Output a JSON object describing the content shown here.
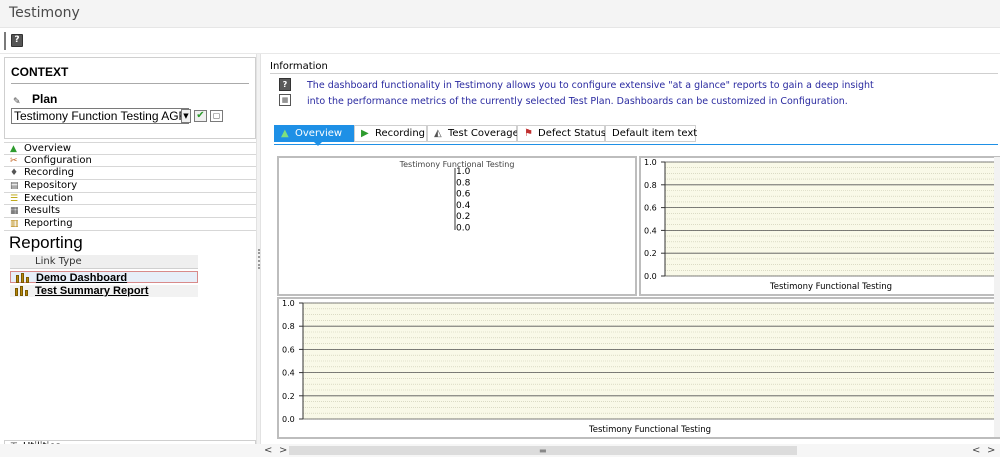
{
  "app": {
    "title": "Testimony"
  },
  "toolbar": {
    "help_icon": "help-icon"
  },
  "context": {
    "title": "CONTEXT",
    "plan_label": "Plan",
    "plan_value": "Testimony Function Testing AGR"
  },
  "nav": {
    "items": [
      {
        "label": "Overview",
        "icon": "overview-icon"
      },
      {
        "label": "Configuration",
        "icon": "configuration-icon"
      },
      {
        "label": "Recording",
        "icon": "recording-icon"
      },
      {
        "label": "Repository",
        "icon": "repository-icon"
      },
      {
        "label": "Execution",
        "icon": "execution-icon"
      },
      {
        "label": "Results",
        "icon": "results-icon"
      },
      {
        "label": "Reporting",
        "icon": "reporting-icon"
      }
    ]
  },
  "reporting": {
    "heading": "Reporting",
    "column_header": "Link Type",
    "links": [
      "Demo Dashboard",
      "Test Summary Report"
    ]
  },
  "utilities": {
    "label": "Utilities"
  },
  "information": {
    "label": "Information",
    "line1": "The dashboard functionality in Testimony allows you to configure extensive \"at a glance\" reports to gain a deep insight",
    "line2": "into the performance metrics of the currently selected Test Plan. Dashboards can be customized in Configuration."
  },
  "tabs": [
    {
      "label": "Overview",
      "icon": "overview-icon",
      "active": true
    },
    {
      "label": "Recording",
      "icon": "play-icon",
      "active": false
    },
    {
      "label": "Test Coverage",
      "icon": "coverage-icon",
      "active": false
    },
    {
      "label": "Defect Status",
      "icon": "flag-icon",
      "active": false
    },
    {
      "label": "Default item text",
      "icon": "",
      "active": false
    }
  ],
  "chart_data": [
    {
      "type": "bar",
      "title": "Testimony Functional Testing",
      "yticks": [
        "1.0",
        "0.8",
        "0.6",
        "0.4",
        "0.2",
        "0.0"
      ],
      "ylim": [
        0,
        1
      ],
      "categories": [],
      "values": []
    },
    {
      "type": "bar",
      "xlabel": "Testimony Functional Testing",
      "yticks": [
        "1.0",
        "0.8",
        "0.6",
        "0.4",
        "0.2",
        "0.0"
      ],
      "ylim": [
        0,
        1
      ],
      "grid": true,
      "categories": [],
      "values": []
    },
    {
      "type": "bar",
      "xlabel": "Testimony Functional Testing",
      "yticks": [
        "1.0",
        "0.8",
        "0.6",
        "0.4",
        "0.2",
        "0.0"
      ],
      "ylim": [
        0,
        1
      ],
      "grid": true,
      "categories": [],
      "values": []
    }
  ],
  "colors": {
    "accent": "#1e90e6",
    "info_text": "#2a2aa0",
    "plot_bg": "#f9f9e8"
  }
}
